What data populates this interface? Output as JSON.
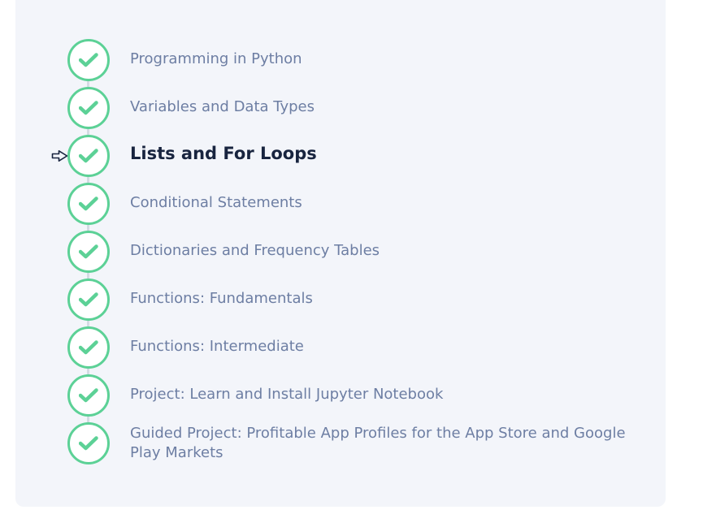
{
  "accent_color": "#5cd196",
  "current_marker_icon": "arrow-right-outline-icon",
  "completed_icon": "checkmark-icon",
  "steps": [
    {
      "label": "Programming in Python",
      "status": "completed"
    },
    {
      "label": "Variables and Data Types",
      "status": "completed"
    },
    {
      "label": "Lists and For Loops",
      "status": "completed",
      "current": true
    },
    {
      "label": "Conditional Statements",
      "status": "completed"
    },
    {
      "label": "Dictionaries and Frequency Tables",
      "status": "completed"
    },
    {
      "label": "Functions: Fundamentals",
      "status": "completed"
    },
    {
      "label": "Functions: Intermediate",
      "status": "completed"
    },
    {
      "label": "Project: Learn and Install Jupyter Notebook",
      "status": "completed"
    },
    {
      "label": "Guided Project: Profitable App Profiles for the App Store and Google Play Markets",
      "status": "completed"
    }
  ]
}
